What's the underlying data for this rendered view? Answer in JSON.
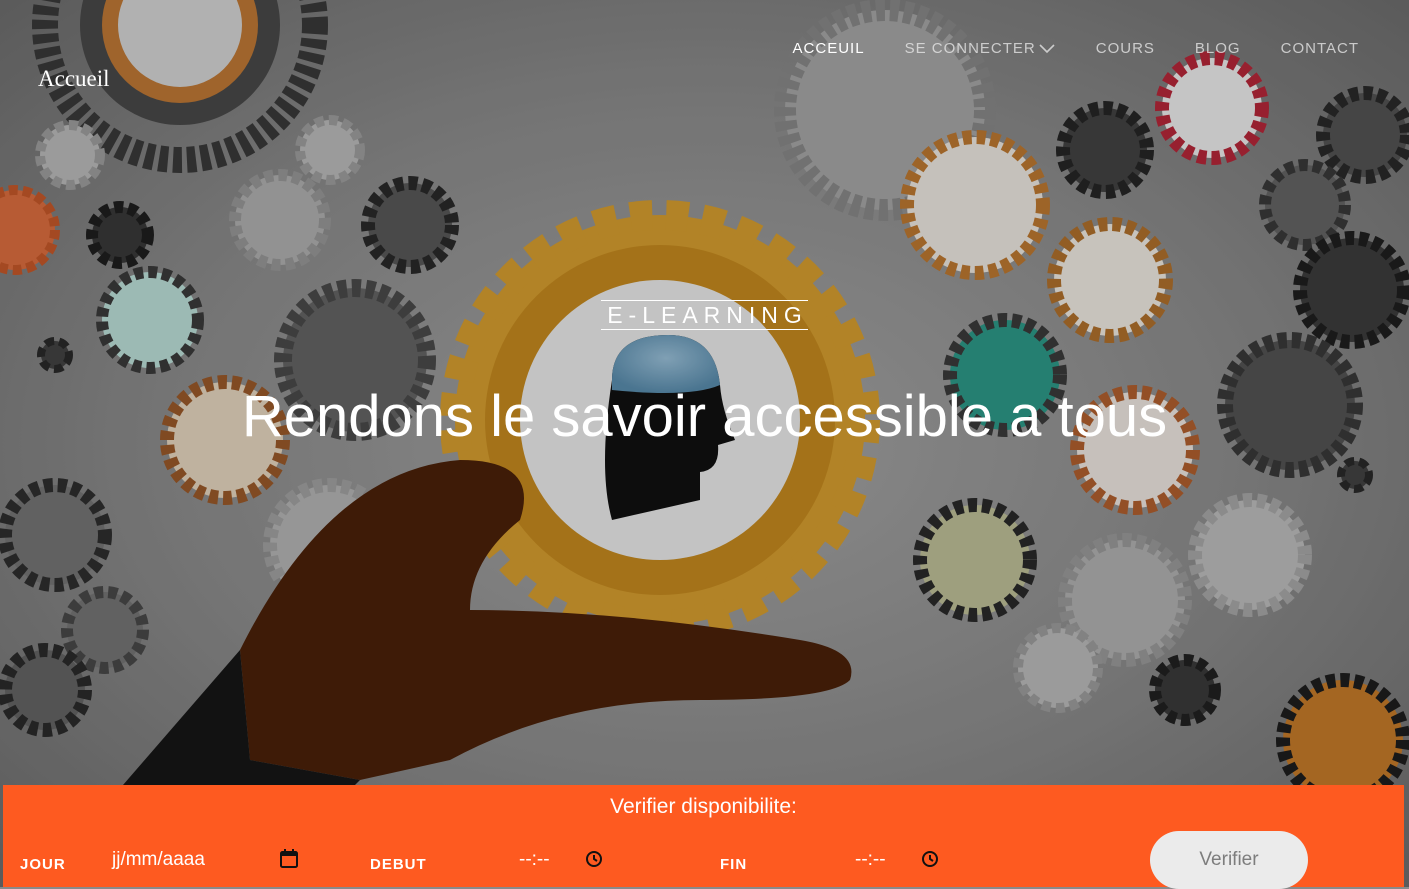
{
  "brand": {
    "label": "Accueil"
  },
  "nav": {
    "items": [
      {
        "label": "ACCEUIL"
      },
      {
        "label": "SE CONNECTER"
      },
      {
        "label": "COURS"
      },
      {
        "label": "BLOG"
      },
      {
        "label": "CONTACT"
      }
    ]
  },
  "hero": {
    "tagline": "E-LEARNING",
    "headline": "Rendons le savoir accessible a tous"
  },
  "booking": {
    "title": "Verifier disponibilite:",
    "jour_label": "JOUR",
    "jour_placeholder": "jj/mm/aaaa",
    "debut_label": "DEBUT",
    "debut_placeholder": "--:--",
    "fin_label": "FIN",
    "fin_placeholder": "--:--",
    "button_label": "Verifier"
  },
  "icons": {
    "calendar": "calendar-icon",
    "clock": "clock-icon",
    "chevron": "chevron-down-icon"
  },
  "colors": {
    "accent": "#fe5a20",
    "button_bg": "#ebebeb",
    "text": "#ffffff"
  }
}
